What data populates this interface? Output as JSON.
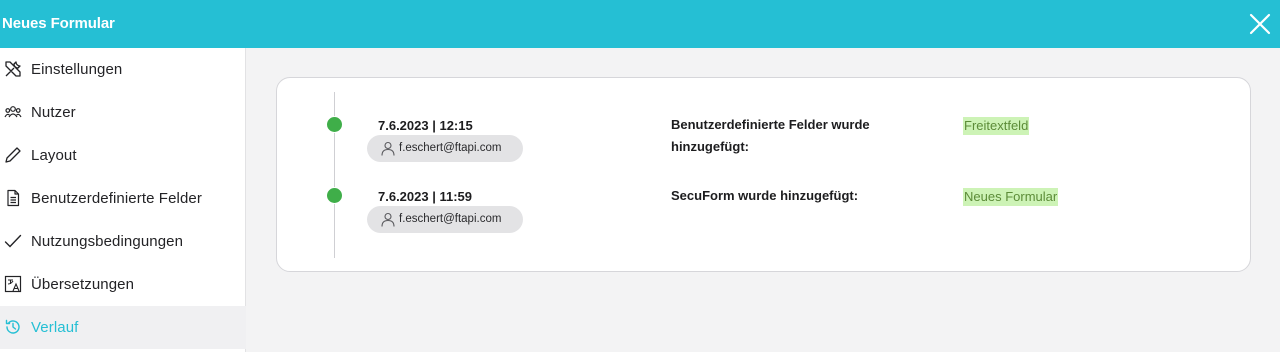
{
  "header": {
    "title": "Neues Formular"
  },
  "sidebar": {
    "items": [
      {
        "label": "Einstellungen",
        "icon": "tools-icon"
      },
      {
        "label": "Nutzer",
        "icon": "users-icon"
      },
      {
        "label": "Layout",
        "icon": "pen-icon"
      },
      {
        "label": "Benutzerdefinierte Felder",
        "icon": "document-icon"
      },
      {
        "label": "Nutzungsbedingungen",
        "icon": "checkmark-icon"
      },
      {
        "label": "Übersetzungen",
        "icon": "translate-icon"
      },
      {
        "label": "Verlauf",
        "icon": "history-icon",
        "active": true
      }
    ]
  },
  "history": {
    "entries": [
      {
        "date": "7.6.2023 | 12:15",
        "user": "f.eschert@ftapi.com",
        "action": "Benutzerdefinierte Felder wurde hinzugefügt:",
        "value": "Freitextfeld"
      },
      {
        "date": "7.6.2023 | 11:59",
        "user": "f.eschert@ftapi.com",
        "action": "SecuForm wurde hinzugefügt:",
        "value": "Neues Formular"
      }
    ]
  },
  "colors": {
    "accent": "#25bfd4",
    "status_dot": "#3fae49",
    "value_highlight": "#cdf3b6",
    "value_text": "#5c8c38"
  }
}
